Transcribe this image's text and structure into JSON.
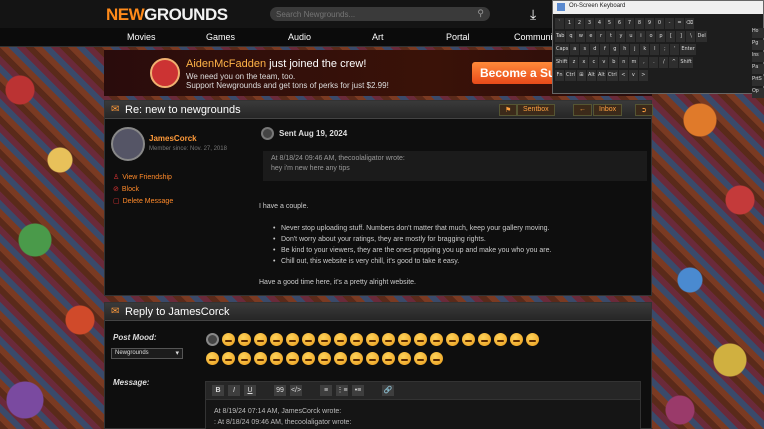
{
  "header": {
    "logo_part1": "NEW",
    "logo_part2": "GROUNDS",
    "search_placeholder": "Search Newgrounds...",
    "search_icon": "search-icon",
    "upload_icon": "upload-arrow-icon"
  },
  "nav": [
    "Movies",
    "Games",
    "Audio",
    "Art",
    "Portal",
    "Communi"
  ],
  "banner": {
    "name": "AidenMcFadden",
    "joined": " just joined the crew!",
    "line2": "We need you on the team, too.",
    "line3": "Support Newgrounds and get tons of perks for just $2.99!",
    "cta": "Become a Su"
  },
  "message": {
    "title": "Re: new to newgrounds",
    "sentbox": "Sentbox",
    "inbox": "Inbox",
    "sender": "JamesCorck",
    "member_since": "Member since: Nov. 27, 2018",
    "actions": [
      "View Friendship",
      "Block",
      "Delete Message"
    ],
    "sent": "Sent Aug 19, 2024",
    "quote_header": "At 8/18/24 09:46 AM, thecoolaligator wrote:",
    "quote_body": "hey i'm new here any tips",
    "intro": "I have a couple.",
    "bullets": [
      "Never stop uploading stuff. Numbers don't matter that much, keep your gallery moving.",
      "Don't worry about your ratings, they are mostly for bragging rights.",
      "Be kind to your viewers, they are the ones propping you up and make you who you are.",
      "Chill out, this website is very chill, it's good to take it easy."
    ],
    "outro": "Have a good time here, it's a pretty alright website."
  },
  "reply": {
    "title": "Reply to JamesCorck",
    "post_mood_label": "Post Mood:",
    "mood_selected": "Newgrounds",
    "message_label": "Message:",
    "toolbar": [
      "B",
      "I",
      "U",
      "99",
      "</>",
      "≡",
      "⋮≡",
      "•≡",
      "🔗"
    ],
    "editor_line1": "At 8/19/24 07:14 AM, JamesCorck wrote:",
    "editor_line2": ": At 8/18/24 09:46 AM, thecoolaligator wrote:"
  },
  "osk": {
    "title": "On-Screen Keyboard",
    "rows": [
      [
        "`",
        "1",
        "2",
        "3",
        "4",
        "5",
        "6",
        "7",
        "8",
        "9",
        "0",
        "-",
        "=",
        "⌫"
      ],
      [
        "Tab",
        "q",
        "w",
        "e",
        "r",
        "t",
        "y",
        "u",
        "i",
        "o",
        "p",
        "[",
        "]",
        "\\",
        "Del"
      ],
      [
        "Caps",
        "a",
        "s",
        "d",
        "f",
        "g",
        "h",
        "j",
        "k",
        "l",
        ";",
        "'",
        "Enter"
      ],
      [
        "Shift",
        "z",
        "x",
        "c",
        "v",
        "b",
        "n",
        "m",
        ",",
        ".",
        "/",
        "^",
        "Shift"
      ],
      [
        "Fn",
        "Ctrl",
        "⊞",
        "Alt",
        "Alt",
        "Ctrl",
        "<",
        "v",
        ">"
      ]
    ],
    "side": [
      "Ho",
      "Pg",
      "Ins",
      "Pa",
      "PrtS",
      "Op"
    ]
  }
}
